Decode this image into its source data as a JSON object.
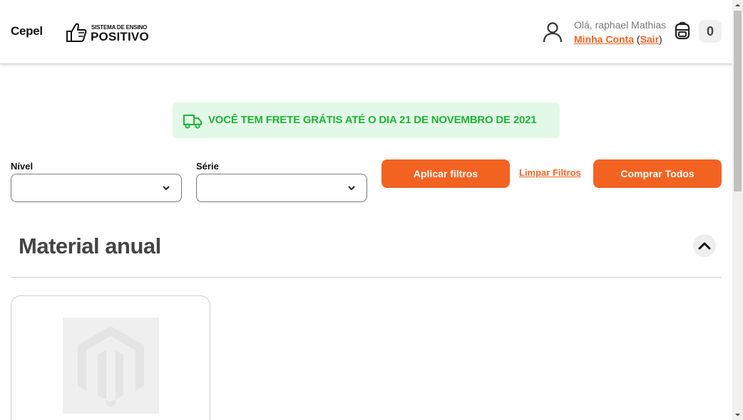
{
  "header": {
    "store_name": "Cepel",
    "logo_line1": "SISTEMA DE ENSINO",
    "logo_line2": "POSITIVO",
    "greeting": "Olá, raphael Mathias",
    "account_link": "Minha Conta",
    "paren_open": "(",
    "logout_link": "Sair",
    "paren_close": ")",
    "cart_count": "0"
  },
  "banner": {
    "text": "VOCÊ TEM FRETE GRÁTIS ATÉ O DIA 21 DE NOVEMBRO DE 2021",
    "icon": "truck-icon"
  },
  "filters": {
    "level_label": "Nível",
    "level_value": "",
    "grade_label": "Série",
    "grade_value": "",
    "apply_label": "Aplicar filtros",
    "clear_label": "Limpar Filtros",
    "buy_all_label": "Comprar Todos"
  },
  "section": {
    "title": "Material anual",
    "toggle_icon": "chevron-up-icon"
  },
  "colors": {
    "accent": "#f26322",
    "banner_bg": "#e3f8e6",
    "banner_text": "#1fb43a"
  }
}
